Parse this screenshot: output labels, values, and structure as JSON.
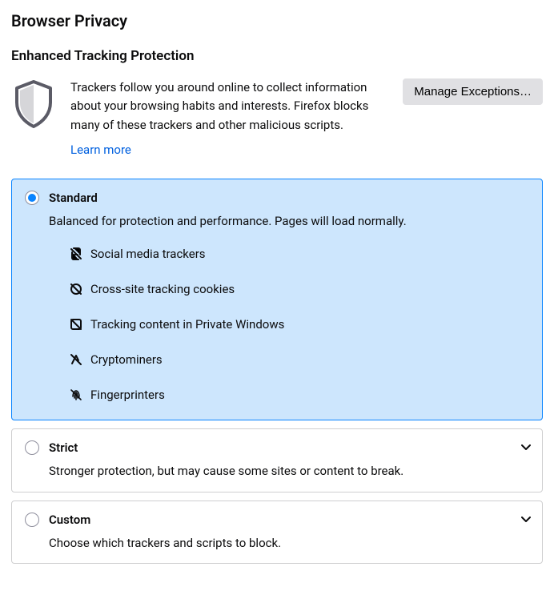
{
  "page_title": "Browser Privacy",
  "section_title": "Enhanced Tracking Protection",
  "intro_text": "Trackers follow you around online to collect information about your browsing habits and interests. Firefox blocks many of these trackers and other malicious scripts.",
  "learn_more_label": "Learn more",
  "manage_exceptions_label": "Manage Exceptions…",
  "options": {
    "standard": {
      "name": "Standard",
      "description": "Balanced for protection and performance. Pages will load normally.",
      "selected": true,
      "trackers": [
        {
          "icon": "social-tracker-icon",
          "label": "Social media trackers"
        },
        {
          "icon": "cookie-blocked-icon",
          "label": "Cross-site tracking cookies"
        },
        {
          "icon": "tracking-content-icon",
          "label": "Tracking content in Private Windows"
        },
        {
          "icon": "cryptominer-icon",
          "label": "Cryptominers"
        },
        {
          "icon": "fingerprinter-icon",
          "label": "Fingerprinters"
        }
      ]
    },
    "strict": {
      "name": "Strict",
      "description": "Stronger protection, but may cause some sites or content to break.",
      "selected": false
    },
    "custom": {
      "name": "Custom",
      "description": "Choose which trackers and scripts to block.",
      "selected": false
    }
  }
}
